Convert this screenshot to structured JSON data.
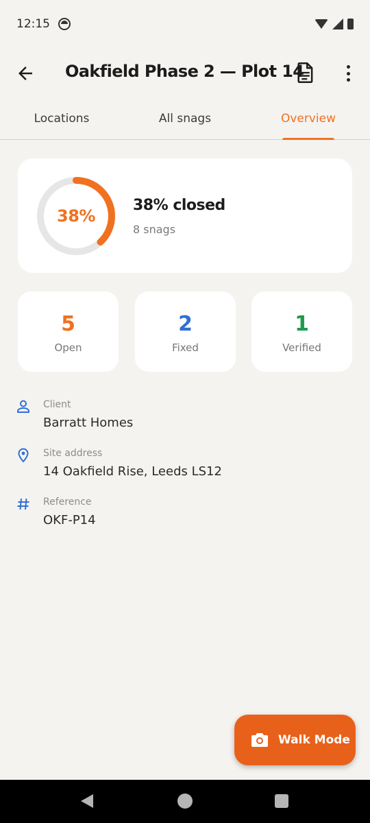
{
  "status_bar": {
    "time": "12:15"
  },
  "app_bar": {
    "title": "Oakfield Phase 2 — Plot 14"
  },
  "tabs": [
    {
      "label": "Locations"
    },
    {
      "label": "All snags"
    },
    {
      "label": "Overview",
      "active": true
    }
  ],
  "progress": {
    "percent_label": "38%",
    "fraction_closed": 0.38,
    "title": "38% closed",
    "subtitle": "8 snags"
  },
  "stats": [
    {
      "value": "5",
      "label": "Open",
      "color": "#f07120"
    },
    {
      "value": "2",
      "label": "Fixed",
      "color": "#2f6fd6"
    },
    {
      "value": "1",
      "label": "Verified",
      "color": "#1f9a4e"
    }
  ],
  "details": [
    {
      "icon": "person-icon",
      "label": "Client",
      "value": "Barratt Homes"
    },
    {
      "icon": "location-pin-icon",
      "label": "Site address",
      "value": "14 Oakfield Rise, Leeds LS12"
    },
    {
      "icon": "hash-icon",
      "label": "Reference",
      "value": "OKF-P14"
    }
  ],
  "fab": {
    "label": "Walk Mode",
    "icon": "camera-icon"
  },
  "colors": {
    "accent": "#f07120",
    "fab": "#e8611a",
    "detail_icon": "#2f6fd6"
  }
}
